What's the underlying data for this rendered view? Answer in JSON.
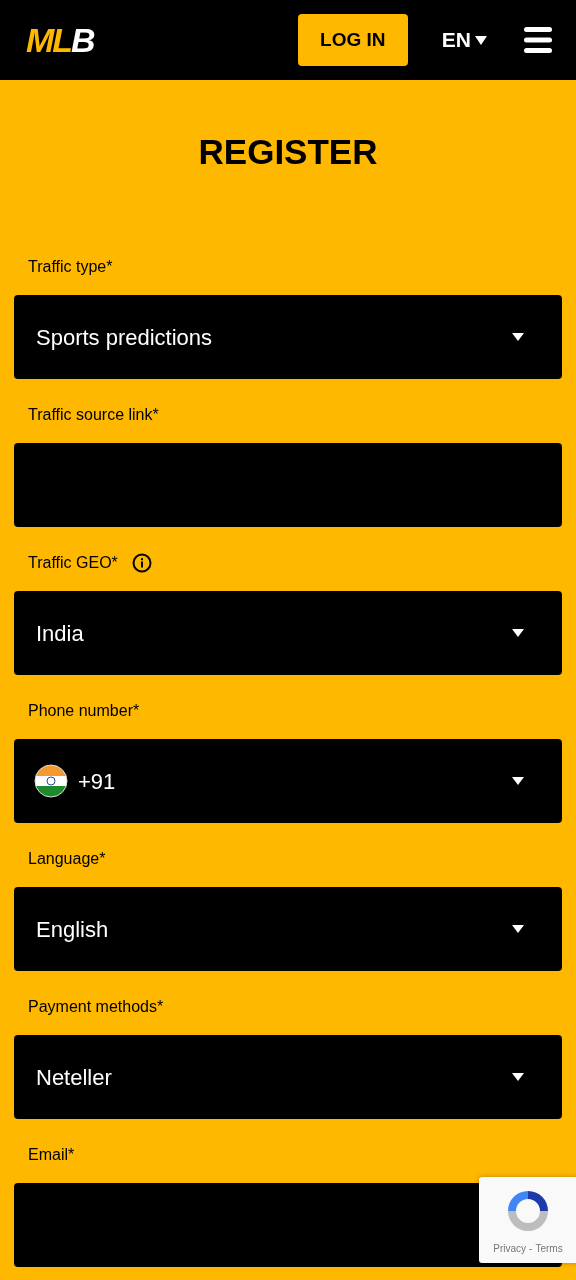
{
  "header": {
    "logo": {
      "accent": "ML",
      "rest": "B"
    },
    "login_button": "LOG IN",
    "language": "EN"
  },
  "title": "REGISTER",
  "fields": [
    {
      "kind": "select",
      "label": "Traffic type*",
      "value": "Sports predictions"
    },
    {
      "kind": "text",
      "label": "Traffic source link*"
    },
    {
      "kind": "select",
      "label": "Traffic GEO*",
      "value": "India",
      "info": true
    },
    {
      "kind": "phone",
      "label": "Phone number*",
      "value": "+91"
    },
    {
      "kind": "select",
      "label": "Language*",
      "value": "English"
    },
    {
      "kind": "select",
      "label": "Payment methods*",
      "value": "Neteller"
    },
    {
      "kind": "text",
      "label": "Email*"
    }
  ],
  "recaptcha": {
    "privacy": "Privacy",
    "separator": "-",
    "terms": "Terms"
  }
}
